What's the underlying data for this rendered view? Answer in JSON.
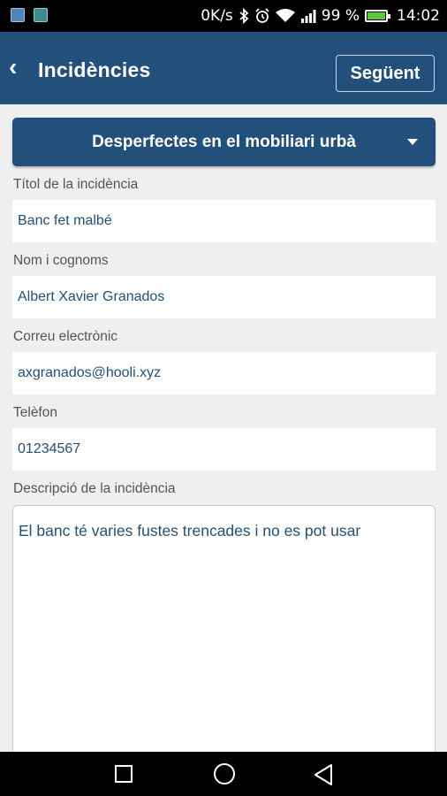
{
  "status_bar": {
    "net_speed": "0K/s",
    "battery_percent": "99 %",
    "time": "14:02",
    "icons": [
      "app-notification-icon",
      "image-notification-icon",
      "bluetooth-icon",
      "alarm-icon",
      "wifi-icon",
      "signal-icon",
      "battery-charging-icon"
    ]
  },
  "app_bar": {
    "back_icon": "chevron-left-icon",
    "title": "Incidències",
    "next_label": "Següent",
    "color": "#23507a"
  },
  "category_select": {
    "value": "Desperfectes en el mobiliari urbà",
    "icon": "caret-down-icon"
  },
  "form": {
    "title_label": "Títol de la incidència",
    "title_value": "Banc fet malbé",
    "name_label": "Nom i cognoms",
    "name_value": "Albert Xavier Granados",
    "email_label": "Correu electrònic",
    "email_value": "axgranados@hooli.xyz",
    "phone_label": "Telèfon",
    "phone_value": "01234567",
    "description_label": "Descripció de la incidència",
    "description_value": "El banc té varies fustes trencades i no es pot usar"
  },
  "nav_bar": {
    "icons": [
      "recents-square-icon",
      "home-circle-icon",
      "back-triangle-icon"
    ]
  }
}
